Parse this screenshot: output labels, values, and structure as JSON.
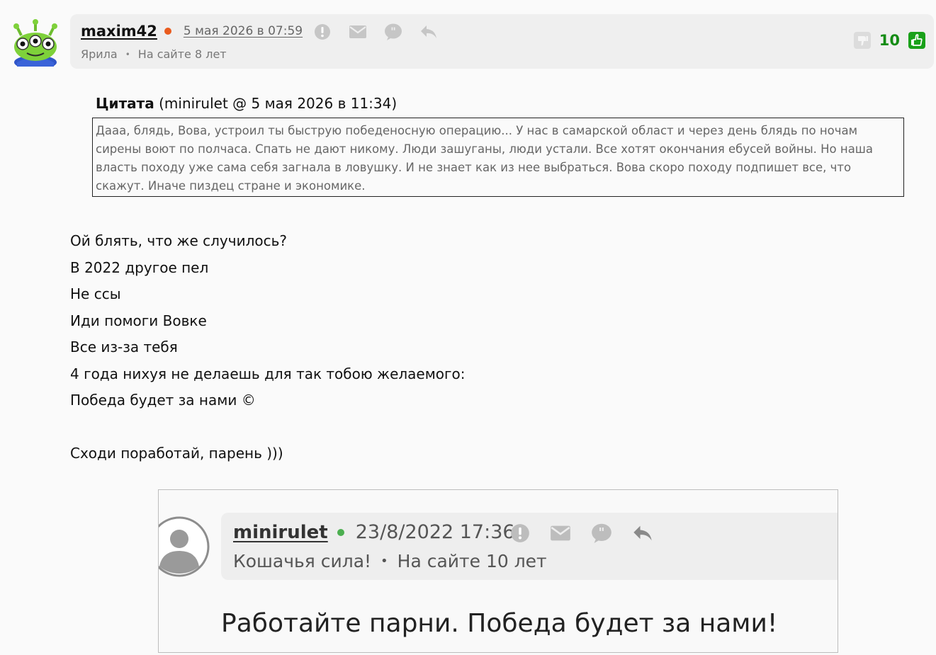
{
  "post": {
    "username": "maxim42",
    "date": "5 мая 2026 в 07:59",
    "title": "Ярила",
    "separator": "•",
    "on_site": "На сайте 8 лет",
    "score": "10",
    "colors": {
      "online": "#e95b1e",
      "score": "#158c15"
    }
  },
  "quote": {
    "label": "Цитата",
    "source": "(minirulet @ 5 мая 2026 в 11:34)",
    "text": "Дааа, блядь, Вова, устроил ты быструю победеносную операцию... У нас в самарской област и через день блядь по ночам сирены воют по полчаса. Спать не дают никому. Люди зашуганы, люди устали. Все хотят окончания ебусей войны. Но наша власть походу уже сама себя загнала в ловушку. И не знает как из нее выбраться. Вова скоро походу подпишет все, что скажут. Иначе пиздец стране и экономике."
  },
  "body": {
    "lines": [
      "Ой блять, что же случилось?",
      "В 2022 другое пел",
      "Не ссы",
      "Иди помоги Вовке",
      "Все из-за тебя",
      "4 года нихуя не делаешь для так тобою желаемого:",
      "Победа будет за нами ©",
      "",
      "Сходи поработай, парень )))"
    ]
  },
  "embed": {
    "username": "minirulet",
    "date": "23/8/2022 17:36",
    "title": "Кошачья сила!",
    "separator": "•",
    "on_site": "На сайте 10 лет",
    "text": "Работайте парни. Победа будет за нами!"
  }
}
